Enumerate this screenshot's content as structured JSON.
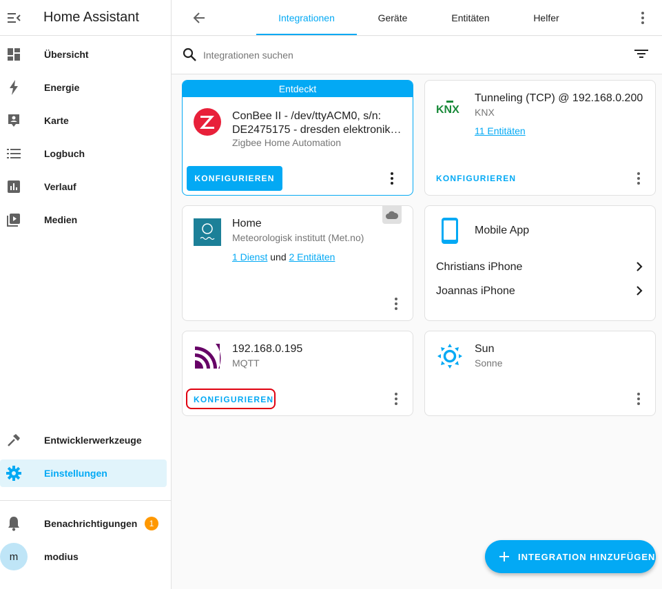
{
  "app": {
    "title": "Home Assistant"
  },
  "sidebar": {
    "items": [
      {
        "label": "Übersicht",
        "icon": "dashboard-icon"
      },
      {
        "label": "Energie",
        "icon": "lightning-icon"
      },
      {
        "label": "Karte",
        "icon": "map-account-icon"
      },
      {
        "label": "Logbuch",
        "icon": "list-icon"
      },
      {
        "label": "Verlauf",
        "icon": "chart-bar-icon"
      },
      {
        "label": "Medien",
        "icon": "play-box-icon"
      }
    ],
    "bottom": [
      {
        "label": "Entwicklerwerkzeuge",
        "icon": "hammer-icon"
      },
      {
        "label": "Einstellungen",
        "icon": "gear-icon",
        "active": true
      }
    ],
    "notifications": {
      "label": "Benachrichtigungen",
      "count": "1"
    },
    "user": {
      "initial": "m",
      "name": "modius"
    }
  },
  "topbar": {
    "tabs": [
      {
        "label": "Integrationen",
        "active": true
      },
      {
        "label": "Geräte"
      },
      {
        "label": "Entitäten"
      },
      {
        "label": "Helfer"
      }
    ]
  },
  "search": {
    "placeholder": "Integrationen suchen",
    "value": ""
  },
  "cards": {
    "conbee": {
      "header": "Entdeckt",
      "title_line1": "ConBee II - /dev/ttyACM0, s/n:",
      "title_line2": "DE2475175 - dresden elektronik…",
      "subtitle": "Zigbee Home Automation",
      "button": "KONFIGURIEREN"
    },
    "knx": {
      "logo_text": "KNX",
      "title": "Tunneling (TCP) @ 192.168.0.200",
      "subtitle": "KNX",
      "link": "11 Entitäten",
      "button": "KONFIGURIEREN"
    },
    "home": {
      "title": "Home",
      "subtitle": "Meteorologisk institutt (Met.no)",
      "link1": "1 Dienst",
      "connector": "und",
      "link2": "2 Entitäten"
    },
    "mobile": {
      "title": "Mobile App",
      "devices": [
        "Christians iPhone",
        "Joannas iPhone"
      ]
    },
    "mqtt": {
      "title": "192.168.0.195",
      "subtitle": "MQTT",
      "button": "KONFIGURIEREN"
    },
    "sun": {
      "title": "Sun",
      "subtitle": "Sonne"
    }
  },
  "fab": {
    "label": "INTEGRATION HINZUFÜGEN"
  },
  "colors": {
    "accent": "#03a9f4",
    "badge": "#ff9800",
    "highlight": "#e0000f",
    "zigbee": "#e8203a",
    "mqtt": "#660066",
    "metno": "#1c8098"
  }
}
